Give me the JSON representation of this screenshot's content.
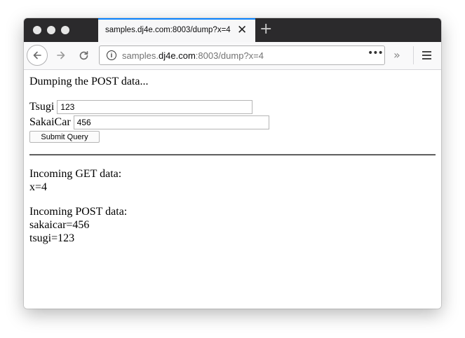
{
  "browser": {
    "tab_title": "samples.dj4e.com:8003/dump?x=4",
    "url_host_prefix": "samples.",
    "url_host": "dj4e.com",
    "url_rest": ":8003/dump?x=4",
    "page_actions_label": "•••"
  },
  "page": {
    "heading": "Dumping the POST data...",
    "form": {
      "tsugi_label": "Tsugi",
      "tsugi_value": "123",
      "sakaicar_label": "SakaiCar",
      "sakaicar_value": "456",
      "submit_label": "Submit Query"
    },
    "get_section": {
      "title": "Incoming GET data:",
      "lines": [
        "x=4"
      ]
    },
    "post_section": {
      "title": "Incoming POST data:",
      "lines": [
        "sakaicar=456",
        "tsugi=123"
      ]
    }
  }
}
